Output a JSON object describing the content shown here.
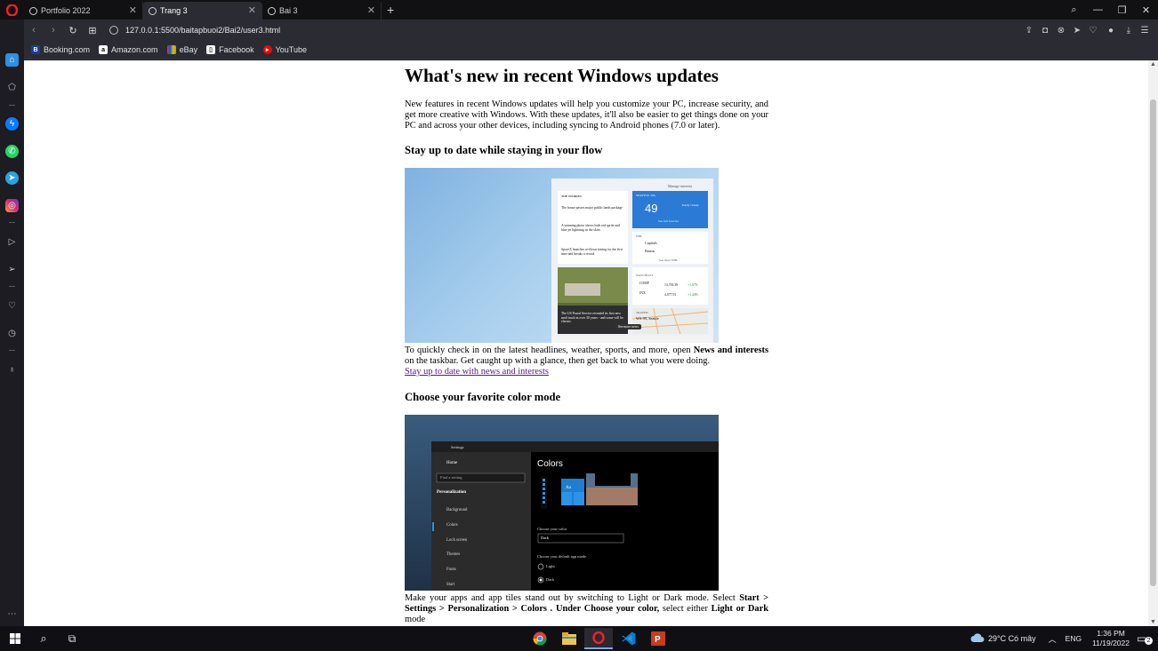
{
  "browser": {
    "tabs": [
      {
        "label": "Portfolio 2022",
        "active": false
      },
      {
        "label": "Trang 3",
        "active": true
      },
      {
        "label": "Bai 3",
        "active": false
      }
    ],
    "url": "127.0.0.1:5500/baitapbuoi2/Bai2/user3.html",
    "bookmarks": [
      "Booking.com",
      "Amazon.com",
      "eBay",
      "Facebook",
      "YouTube"
    ]
  },
  "article": {
    "title": "What's new in recent Windows updates",
    "intro": "New features in recent Windows updates will help you customize your PC, increase security, and get more creative with Windows. With these updates, it'll also be easier to get things done on your PC and across your other devices, including syncing to Android phones (7.0 or later).",
    "section1": {
      "heading": "Stay up to date while staying in your flow",
      "text_before": "To quickly check in on the latest headlines, weather, sports, and more, open ",
      "bold": "News and interests",
      "text_after": " on the taskbar. Get caught up with a glance, then get back to what you were doing.",
      "link": "Stay up to date with news and interests",
      "widget": {
        "manage": "Manage interests",
        "top_stories": "TOP STORIES",
        "story1": "The house passes major public lands package",
        "story2": "A stunning photo shows both red sprite and blue jet lightning in the skies",
        "story3": "SpaceX launches re-flown fairing for the first time and breaks a record",
        "location": "SEATTLE, WA",
        "temp": "49",
        "weather": "Partly cloudy",
        "forecast_btn": "See full forecast",
        "nhl": "NHL",
        "team1": "Capitals",
        "team2": "Bruins",
        "see_more_nhl": "See more NHL",
        "watchlist": "WATCHLIST",
        "stock1": "COMP",
        "stock1_val": "13,703.39",
        "stock1_chg": "+1.67%",
        "stock2": "INX",
        "stock2_val": "4,077.91",
        "stock2_chg": "+1.44%",
        "mail_caption": "The US Postal Service revealed its first new mail truck in over 30 years - and some will be electric",
        "traffic": "TRAFFIC",
        "traffic_road": "WA-99, Seattle",
        "see_more_news": "See more news"
      }
    },
    "section2": {
      "heading": "Choose your favorite color mode",
      "settings": {
        "window_title": "Settings",
        "home": "Home",
        "find": "Find a setting",
        "group": "Personalization",
        "items": [
          "Background",
          "Colors",
          "Lock screen",
          "Themes",
          "Fonts",
          "Start"
        ],
        "page_title": "Colors",
        "choose_color": "Choose your color",
        "dropdown": "Dark",
        "app_mode": "Choose your default app mode",
        "opt_light": "Light",
        "opt_dark": "Dark",
        "preview_letter": "Aa"
      },
      "p_before": "Make your apps and app tiles stand out by switching to Light or Dark mode. Select ",
      "b1": "Start > Settings > Personalization > Colors . Under Choose your color,",
      "p_mid": " select either ",
      "b2": "Light or Dark",
      "p_after": " mode"
    }
  },
  "taskbar": {
    "weather": "29°C  Có mây",
    "lang": "ENG",
    "time": "1:36 PM",
    "date": "11/19/2022",
    "notif_count": "2"
  },
  "colors": {
    "opera_red": "#ff1b2d",
    "link": "#551a8b",
    "page_bg": "#ffffff",
    "chrome_bg": "#2b2c33"
  }
}
